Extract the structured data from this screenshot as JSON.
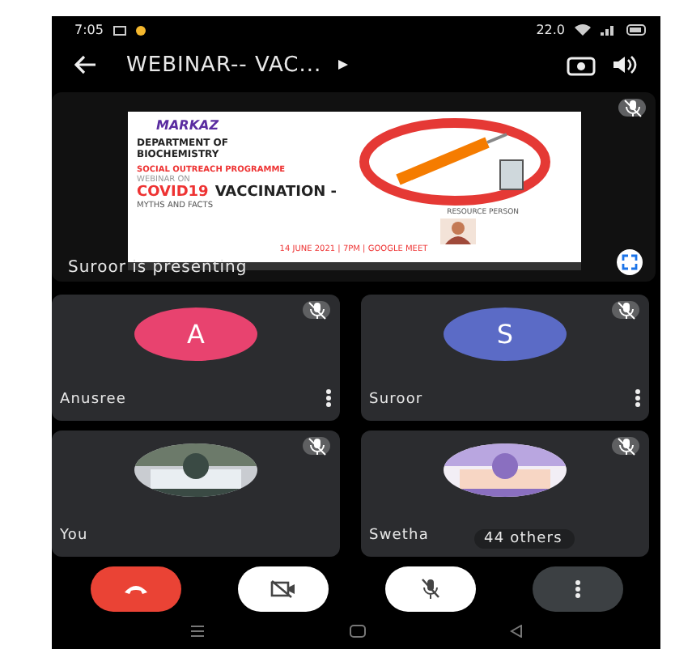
{
  "status_bar": {
    "time": "7:05",
    "speed": "22.0"
  },
  "top_bar": {
    "title": "WEBINAR-- VAC..."
  },
  "presentation": {
    "caption": "Suroor is presenting",
    "muted": true,
    "slide": {
      "logo": "MARKAZ",
      "department": "DEPARTMENT OF BIOCHEMISTRY",
      "programme": "SOCIAL OUTREACH PROGRAMME",
      "webinar_label": "WEBINAR ON",
      "topic_highlight": "COVID19",
      "topic_rest": "VACCINATION -",
      "subtitle": "MYTHS AND FACTS",
      "resource_label": "RESOURCE PERSON",
      "date_line": "14 JUNE 2021 | 7PM | GOOGLE MEET"
    }
  },
  "participants": [
    {
      "name": "Anusree",
      "kind": "initial",
      "initial": "A",
      "color": "#e8436f",
      "muted": true,
      "menu": true
    },
    {
      "name": "Suroor",
      "kind": "initial",
      "initial": "S",
      "color": "#5b6bc6",
      "muted": true,
      "menu": true
    },
    {
      "name": "You",
      "kind": "picture",
      "muted": true,
      "menu": false
    },
    {
      "name": "Swetha",
      "kind": "picture",
      "muted": true,
      "menu": false,
      "overflow": "44 others"
    }
  ],
  "controls": [
    {
      "kind": "hangup"
    },
    {
      "kind": "camera",
      "on": false
    },
    {
      "kind": "mic",
      "on": false
    },
    {
      "kind": "more"
    }
  ]
}
